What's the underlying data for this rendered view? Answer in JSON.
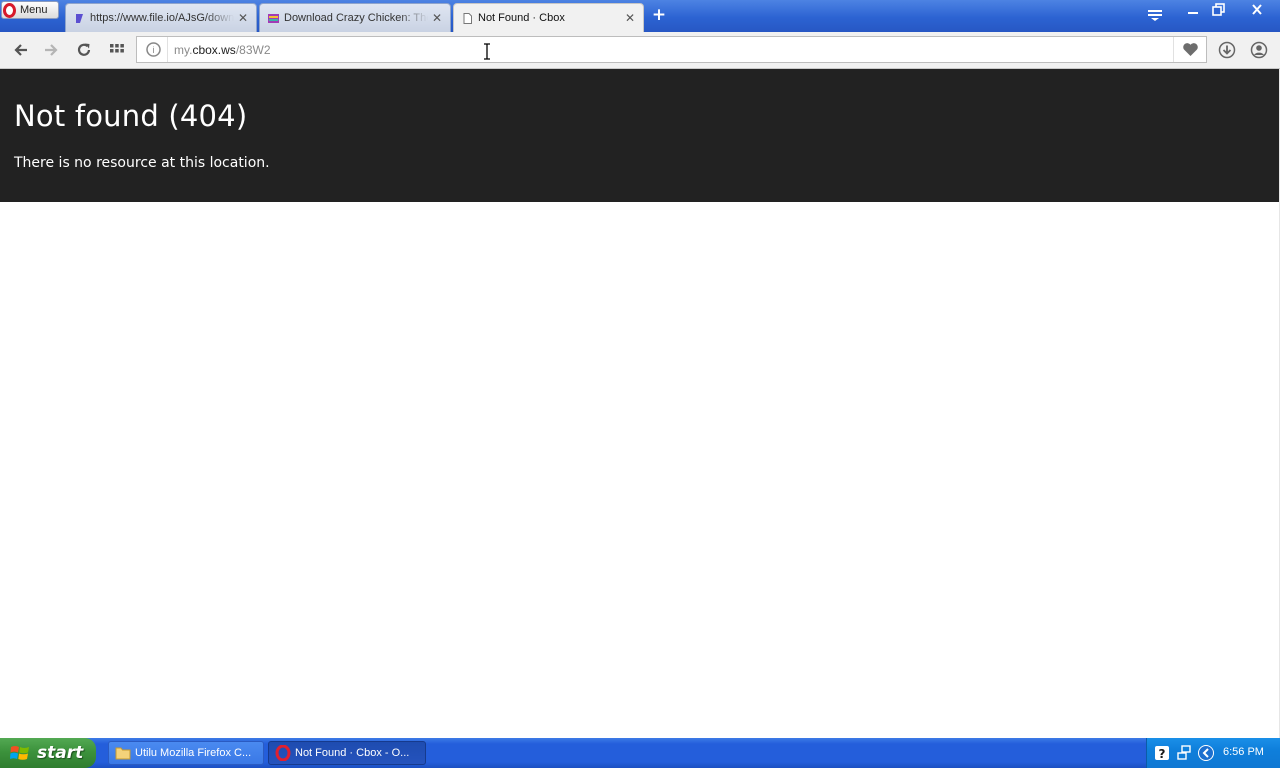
{
  "browser": {
    "menu_label": "Menu",
    "tabs": [
      {
        "title": "https://www.file.io/AJsG/download",
        "active": false
      },
      {
        "title": "Download Crazy Chicken: The Winged Pharaoh",
        "active": false
      },
      {
        "title": "Not Found · Cbox",
        "active": true
      }
    ],
    "address": {
      "prefix": "my.",
      "host": "cbox.ws",
      "path": "/83W2"
    }
  },
  "page": {
    "heading": "Not found (404)",
    "message": "There is no resource at this location.",
    "header_bg": "#222222"
  },
  "taskbar": {
    "start_label": "start",
    "tasks": [
      {
        "label": "Utilu Mozilla Firefox C...",
        "icon": "folder-icon",
        "active": false
      },
      {
        "label": "Not Found · Cbox - O...",
        "icon": "opera-icon",
        "active": true
      }
    ],
    "clock": "6:56 PM"
  }
}
